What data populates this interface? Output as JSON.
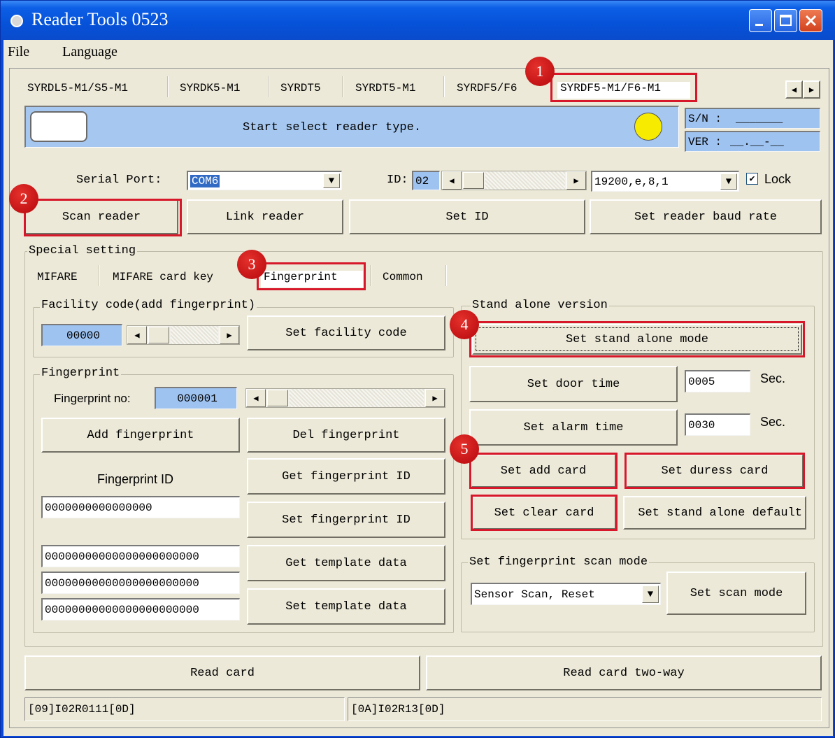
{
  "window": {
    "title": "Reader Tools 0523"
  },
  "menu": [
    "File",
    "Language"
  ],
  "reader_tabs": [
    "SYRDL5-M1/S5-M1",
    "SYRDK5-M1",
    "SYRDT5",
    "SYRDT5-M1",
    "SYRDF5/F6",
    "SYRDF5-M1/F6-M1"
  ],
  "status_panel": {
    "message": "Start select reader type.",
    "indicator_color": "#f7ec00",
    "sn_label": "S/N :",
    "sn_value": "_______",
    "ver_label": "VER :",
    "ver_value": "__.__-__"
  },
  "connection": {
    "serial_port_label": "Serial Port:",
    "serial_port_value": "COM6",
    "id_label": "ID:",
    "id_value": "02",
    "baud_value": "19200,e,8,1",
    "lock_label": "Lock",
    "lock_checked": true,
    "scan_reader": "Scan reader",
    "link_reader": "Link reader",
    "set_id": "Set ID",
    "set_baud": "Set reader baud rate"
  },
  "special": {
    "title": "Special setting",
    "tabs": [
      "MIFARE",
      "MIFARE card key",
      "Fingerprint",
      "Common"
    ],
    "selected_tab": "Fingerprint"
  },
  "facility": {
    "title": "Facility code(add fingerprint)",
    "value": "00000",
    "set_button": "Set facility code"
  },
  "fingerprint": {
    "title": "Fingerprint",
    "no_label": "Fingerprint no:",
    "no_value": "000001",
    "add_button": "Add fingerprint",
    "del_button": "Del fingerprint",
    "id_label": "Fingerprint ID",
    "get_id_button": "Get fingerprint ID",
    "id_value": "0000000000000000",
    "set_id_button": "Set fingerprint ID",
    "template_fields": [
      "00000000000000000000000",
      "00000000000000000000000",
      "00000000000000000000000"
    ],
    "get_template_button": "Get template data",
    "set_template_button": "Set template data"
  },
  "standalone": {
    "title": "Stand alone version",
    "set_mode_button": "Set stand alone mode",
    "set_door_time_button": "Set door time",
    "door_time_value": "0005",
    "alarm_time_value": "0030",
    "sec_label": "Sec.",
    "set_alarm_time_button": "Set alarm time",
    "set_add_card_button": "Set add card",
    "set_duress_card_button": "Set duress card",
    "set_clear_card_button": "Set clear card",
    "set_default_button": "Set stand alone default"
  },
  "scan_mode": {
    "title": "Set fingerprint scan mode",
    "value": "Sensor Scan, Reset",
    "set_button": "Set scan mode"
  },
  "bottom": {
    "read_card": "Read card",
    "read_card_two_way": "Read card two-way",
    "status_left": "[09]I02R0111[0D]",
    "status_right": "[0A]I02R13[0D]"
  },
  "annotations": [
    "1",
    "2",
    "3",
    "4",
    "5"
  ],
  "colors": {
    "highlight": "#d7172a",
    "blue_field": "#9ec3f1",
    "title_bar": "#0652d8"
  }
}
